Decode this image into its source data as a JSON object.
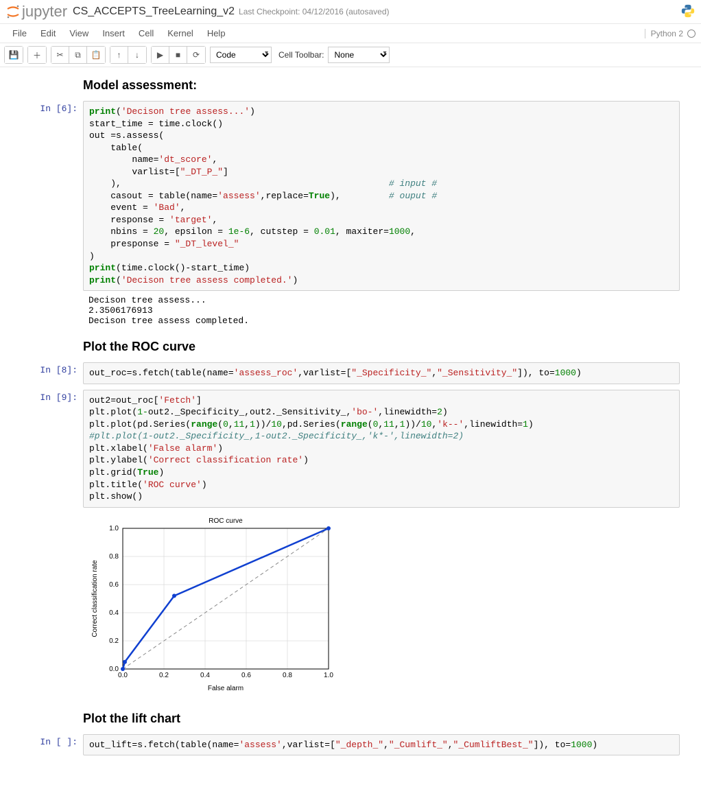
{
  "header": {
    "logo_text": "jupyter",
    "notebook_name": "CS_ACCEPTS_TreeLearning_v2",
    "checkpoint": "Last Checkpoint: 04/12/2016 (autosaved)"
  },
  "menubar": {
    "items": [
      "File",
      "Edit",
      "View",
      "Insert",
      "Cell",
      "Kernel",
      "Help"
    ],
    "kernel": "Python 2"
  },
  "toolbar": {
    "cell_type": "Code",
    "cell_toolbar_label": "Cell Toolbar:",
    "cell_toolbar_value": "None"
  },
  "md": {
    "model_assessment": "Model assessment:",
    "plot_roc": "Plot the ROC curve",
    "plot_lift": "Plot the lift chart"
  },
  "prompts": {
    "p6": "In [6]:",
    "p8": "In [8]:",
    "p9": "In [9]:",
    "pempty": "In [ ]:"
  },
  "code": {
    "cell6": "print('Decison tree assess...')\nstart_time = time.clock()\nout =s.assess(\n    table(\n        name='dt_score',\n        varlist=[\"_DT_P_\"]\n    ),                                                  # input #\n    casout = table(name='assess',replace=True),         # ouput #\n    event = 'Bad',\n    response = 'target',\n    nbins = 20, epsilon = 1e-6, cutstep = 0.01, maxiter=1000,\n    presponse = \"_DT_level_\"\n)\nprint(time.clock()-start_time)\nprint('Decison tree assess completed.')",
    "out6": "Decison tree assess...\n2.3506176913\nDecison tree assess completed.",
    "cell8": "out_roc=s.fetch(table(name='assess_roc',varlist=[\"_Specificity_\",\"_Sensitivity_\"]), to=1000)",
    "cell9": "out2=out_roc['Fetch']\nplt.plot(1-out2._Specificity_,out2._Sensitivity_,'bo-',linewidth=2)\nplt.plot(pd.Series(range(0,11,1))/10,pd.Series(range(0,11,1))/10,'k--',linewidth=1)\n#plt.plot(1-out2._Specificity_,1-out2._Specificity_,'k*-',linewidth=2)\nplt.xlabel('False alarm')\nplt.ylabel('Correct classification rate')\nplt.grid(True)\nplt.title('ROC curve')\nplt.show()",
    "cell_lift": "out_lift=s.fetch(table(name='assess',varlist=[\"_depth_\",\"_Cumlift_\",\"_CumliftBest_\"]), to=1000)"
  },
  "chart_data": {
    "type": "line",
    "title": "ROC curve",
    "xlabel": "False alarm",
    "ylabel": "Correct classification rate",
    "xlim": [
      0.0,
      1.0
    ],
    "ylim": [
      0.0,
      1.0
    ],
    "xticks": [
      0.0,
      0.2,
      0.4,
      0.6,
      0.8,
      1.0
    ],
    "yticks": [
      0.0,
      0.2,
      0.4,
      0.6,
      0.8,
      1.0
    ],
    "series": [
      {
        "name": "ROC",
        "style": "bo-",
        "x": [
          0.0,
          0.01,
          0.25,
          1.0
        ],
        "y": [
          0.0,
          0.05,
          0.52,
          1.0
        ]
      },
      {
        "name": "diagonal",
        "style": "k--",
        "x": [
          0.0,
          0.1,
          0.2,
          0.3,
          0.4,
          0.5,
          0.6,
          0.7,
          0.8,
          0.9,
          1.0
        ],
        "y": [
          0.0,
          0.1,
          0.2,
          0.3,
          0.4,
          0.5,
          0.6,
          0.7,
          0.8,
          0.9,
          1.0
        ]
      }
    ]
  }
}
